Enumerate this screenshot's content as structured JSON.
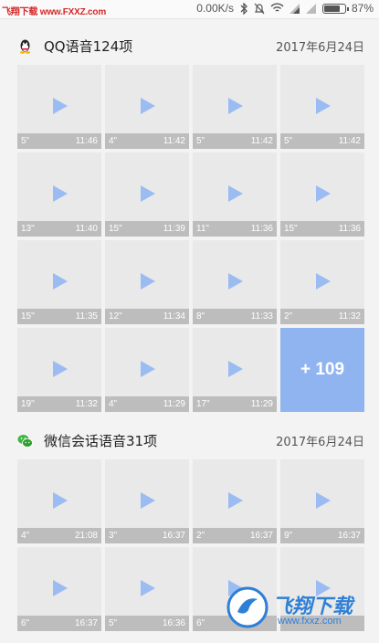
{
  "statusbar": {
    "watermark": "飞翔下载 www.FXXZ.com",
    "network_speed": "0.00K/s",
    "battery_percent": "87%",
    "battery_level": 0.87
  },
  "sections": [
    {
      "app": "QQ",
      "icon": "qq-penguin-icon",
      "title": "QQ语音124项",
      "date": "2017年6月24日",
      "tiles": [
        {
          "duration": "5\"",
          "time": "11:46"
        },
        {
          "duration": "4\"",
          "time": "11:42"
        },
        {
          "duration": "5\"",
          "time": "11:42"
        },
        {
          "duration": "5\"",
          "time": "11:42"
        },
        {
          "duration": "13\"",
          "time": "11:40"
        },
        {
          "duration": "15\"",
          "time": "11:39"
        },
        {
          "duration": "11\"",
          "time": "11:36"
        },
        {
          "duration": "15\"",
          "time": "11:36"
        },
        {
          "duration": "15\"",
          "time": "11:35"
        },
        {
          "duration": "12\"",
          "time": "11:34"
        },
        {
          "duration": "8\"",
          "time": "11:33"
        },
        {
          "duration": "2\"",
          "time": "11:32"
        },
        {
          "duration": "19\"",
          "time": "11:32"
        },
        {
          "duration": "4\"",
          "time": "11:29"
        },
        {
          "duration": "17\"",
          "time": "11:29"
        }
      ],
      "more_label": "+ 109"
    },
    {
      "app": "WeChat",
      "icon": "wechat-icon",
      "title": "微信会话语音31项",
      "date": "2017年6月24日",
      "tiles": [
        {
          "duration": "4\"",
          "time": "21:08"
        },
        {
          "duration": "3\"",
          "time": "16:37"
        },
        {
          "duration": "2\"",
          "time": "16:37"
        },
        {
          "duration": "9\"",
          "time": "16:37"
        },
        {
          "duration": "6\"",
          "time": "16:37"
        },
        {
          "duration": "5\"",
          "time": "16:36"
        },
        {
          "duration": "6\"",
          "time": ""
        },
        {
          "duration": "",
          "time": ""
        }
      ]
    }
  ],
  "footer_watermark": {
    "brand": "飞翔下载",
    "site": "www.fxxz.com"
  },
  "colors": {
    "accent": "#8fb4f0",
    "play": "#9bbcf2",
    "tile_bg": "#e9e9e9",
    "meta_bar": "#bdbdbd"
  }
}
